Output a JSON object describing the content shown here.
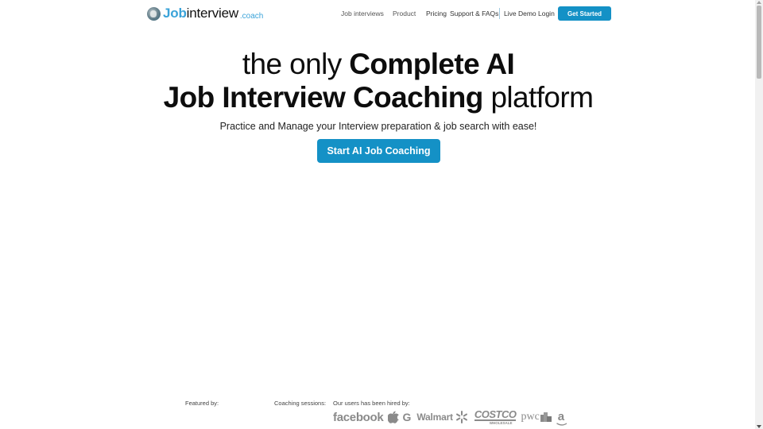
{
  "brand": {
    "name_bold": "Job",
    "name_regular": "interview",
    "name_suffix": ".coach",
    "accent_color": "#3aa3d9",
    "button_color": "#1491c6"
  },
  "nav": {
    "items": [
      {
        "label": "Job interviews"
      },
      {
        "label": "Product"
      },
      {
        "label": "Pricing"
      },
      {
        "label": "Support & FAQs"
      },
      {
        "label": "Live Demo"
      },
      {
        "label": "Login"
      }
    ],
    "cta_label": "Get Started"
  },
  "hero": {
    "line1_thin": "the only ",
    "line1_bold": "Complete AI",
    "line2_bold": "Job Interview Coaching",
    "line2_thin": " platform",
    "subtitle": "Practice and Manage your Interview preparation & job search with ease!",
    "cta_label": "Start AI Job Coaching"
  },
  "footer_strip": {
    "featured_label": "Featured by:",
    "sessions_label": "Coaching sessions:",
    "hired_label": "Our users has been hired by:",
    "brands": {
      "facebook": "facebook",
      "apple": "apple-logo",
      "google": "G",
      "walmart": "Walmart",
      "costco": "COSTCO",
      "costco_sub": "WHOLESALE",
      "pwc": "pwc",
      "amazon": "a"
    }
  }
}
